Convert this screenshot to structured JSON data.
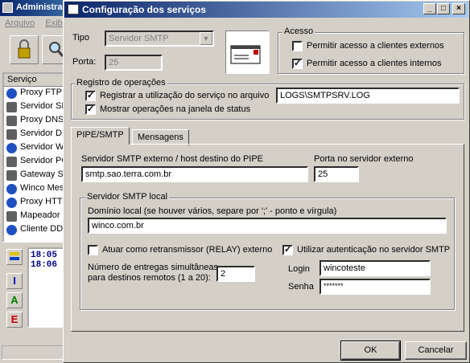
{
  "background_window": {
    "title": "Administra",
    "menu": [
      "Arquivo",
      "Exibi"
    ],
    "list_header": "Serviço",
    "services": [
      "Proxy FTP",
      "Servidor SM",
      "Proxy DNS",
      "Servidor DH",
      "Servidor W",
      "Servidor PO",
      "Gateway S",
      "Winco Mes",
      "Proxy HTTP",
      "Mapeador P",
      "Cliente DDN"
    ],
    "log_lines": [
      "18:05",
      "18:06"
    ],
    "side_buttons": [
      "I",
      "A",
      "E"
    ]
  },
  "dialog": {
    "title": "Configuração dos serviços",
    "tipo_label": "Tipo",
    "tipo_value": "Servidor SMTP",
    "porta_label": "Porta:",
    "porta_value": "25",
    "acesso": {
      "title": "Acesso",
      "externos_label": "Permitir acesso a clientes externos",
      "externos_checked": false,
      "internos_label": "Permitir acesso a clientes internos",
      "internos_checked": true
    },
    "registro": {
      "title": "Registro de operações",
      "registrar_label": "Registrar a utilização do serviço no arquivo",
      "registrar_checked": true,
      "mostrar_label": "Mostrar operações na janela de status",
      "mostrar_checked": true,
      "arquivo_value": "LOGS\\SMTPSRV.LOG"
    },
    "tabs": [
      "PIPE/SMTP",
      "Mensagens"
    ],
    "pipe": {
      "host_label": "Servidor SMTP externo / host destino do PIPE",
      "host_value": "smtp.sao.terra.com.br",
      "porta_ext_label": "Porta no servidor externo",
      "porta_ext_value": "25",
      "local_title": "Servidor SMTP local",
      "dominio_label": "Domínio local (se houver vários, separe por ';' - ponto e vírgula)",
      "dominio_value": "winco.com.br",
      "relay_label": "Atuar como retransmissor (RELAY) externo",
      "relay_checked": false,
      "auth_label": "Utilizar autenticação no servidor SMTP",
      "auth_checked": true,
      "entregas_label_1": "Número de entregas simultâneas",
      "entregas_label_2": "para destinos remotos (1 a 20):",
      "entregas_value": "2",
      "login_label": "Login",
      "login_value": "wincoteste",
      "senha_label": "Senha",
      "senha_value": "*******"
    },
    "ok_label": "OK",
    "cancel_label": "Cancelar",
    "check_glyph": "✓"
  }
}
